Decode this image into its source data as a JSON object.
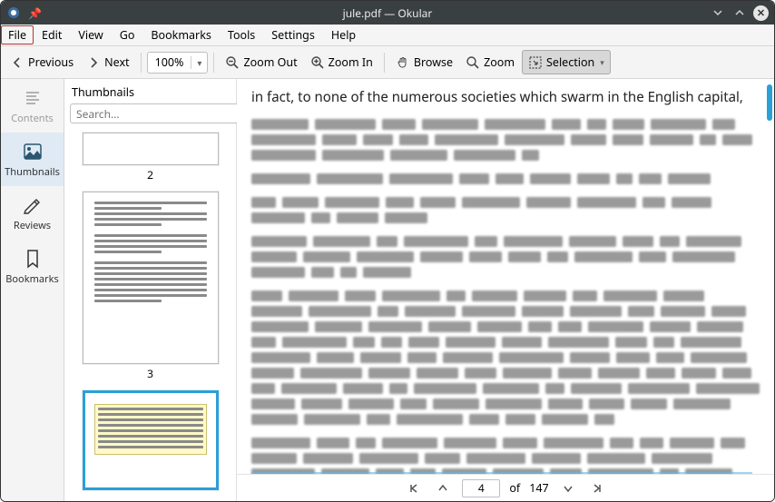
{
  "window": {
    "title": "jule.pdf — Okular"
  },
  "menubar": {
    "items": [
      "File",
      "Edit",
      "View",
      "Go",
      "Bookmarks",
      "Tools",
      "Settings",
      "Help"
    ],
    "highlighted_index": 0
  },
  "toolbar": {
    "previous": "Previous",
    "next": "Next",
    "zoom_value": "100%",
    "zoom_out": "Zoom Out",
    "zoom_in": "Zoom In",
    "browse": "Browse",
    "zoom": "Zoom",
    "selection": "Selection"
  },
  "sidebar": {
    "tabs": [
      {
        "id": "contents",
        "label": "Contents"
      },
      {
        "id": "thumbnails",
        "label": "Thumbnails"
      },
      {
        "id": "reviews",
        "label": "Reviews"
      },
      {
        "id": "bookmarks",
        "label": "Bookmarks"
      }
    ],
    "active": "thumbnails"
  },
  "thumbnails": {
    "title": "Thumbnails",
    "search_placeholder": "Search...",
    "pages": [
      {
        "num": "2",
        "selected": false
      },
      {
        "num": "3",
        "selected": false
      },
      {
        "num": "",
        "selected": true
      }
    ]
  },
  "document": {
    "visible_line": "in fact, to none of the numerous societies which swarm in the English capital,"
  },
  "pager": {
    "current": "4",
    "of_label": "of",
    "total": "147"
  }
}
